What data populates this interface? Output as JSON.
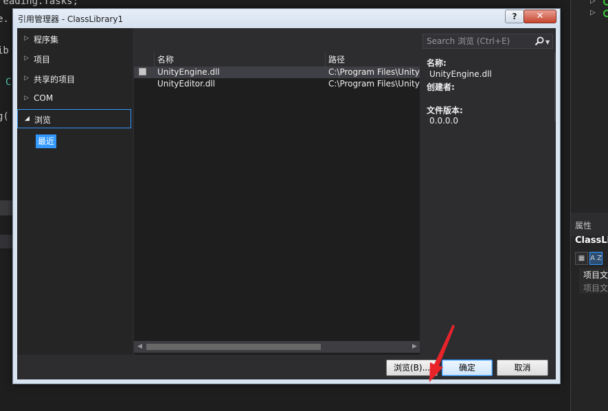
{
  "background": {
    "code_lines": [
      "reading.Tasks;",
      "e.",
      "ib",
      "C",
      "g("
    ]
  },
  "right_panel": {
    "properties_title": "属性",
    "object_name": "ClassLib",
    "row1": "项目文",
    "row2": "项目文",
    "sort_icon_label": "A Z"
  },
  "dialog": {
    "title": "引用管理器 - ClassLibrary1",
    "help_label": "?",
    "close_label": "✕",
    "nav": {
      "items": [
        {
          "label": "程序集",
          "expanded": false
        },
        {
          "label": "项目",
          "expanded": false
        },
        {
          "label": "共享的项目",
          "expanded": false
        },
        {
          "label": "COM",
          "expanded": false
        },
        {
          "label": "浏览",
          "expanded": true
        }
      ],
      "sub_item": "最近"
    },
    "search": {
      "placeholder": "Search 浏览 (Ctrl+E)"
    },
    "list": {
      "columns": [
        "名称",
        "路径"
      ],
      "rows": [
        {
          "name": "UnityEngine.dll",
          "path": "C:\\Program Files\\Unity\\",
          "selected": true
        },
        {
          "name": "UnityEditor.dll",
          "path": "C:\\Program Files\\Unity\\",
          "selected": false
        }
      ]
    },
    "details": {
      "name_label": "名称:",
      "name_value": "UnityEngine.dll",
      "creator_label": "创建者:",
      "version_label": "文件版本:",
      "version_value": "0.0.0.0"
    },
    "buttons": {
      "browse": "浏览(B)...",
      "ok": "确定",
      "cancel": "取消"
    }
  },
  "colors": {
    "accent": "#3399ff",
    "annotation_arrow": "#e8232a",
    "dialog_dark": "#2d2d30"
  }
}
